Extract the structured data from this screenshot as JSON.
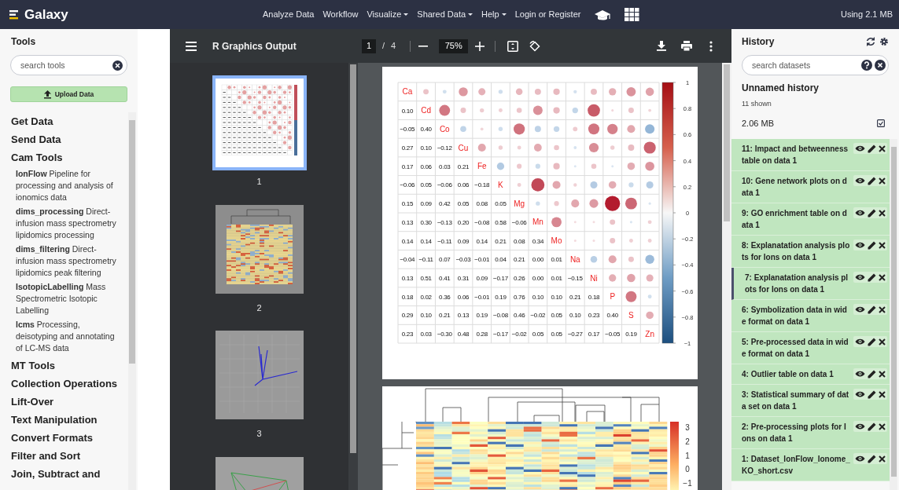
{
  "header": {
    "brand": "Galaxy",
    "nav": [
      {
        "label": "Analyze Data",
        "dropdown": false
      },
      {
        "label": "Workflow",
        "dropdown": false
      },
      {
        "label": "Visualize",
        "dropdown": true
      },
      {
        "label": "Shared Data",
        "dropdown": true
      },
      {
        "label": "Help",
        "dropdown": true
      },
      {
        "label": "Login or Register",
        "dropdown": false
      }
    ],
    "usage": "Using 2.1 MB"
  },
  "tools_panel": {
    "title": "Tools",
    "search": {
      "placeholder": "search tools"
    },
    "upload_button": "Upload Data",
    "sections": [
      {
        "label": "Get Data"
      },
      {
        "label": "Send Data"
      },
      {
        "label": "Cam Tools",
        "children": [
          {
            "text": "**IonFlow** Pipeline for processing and analysis of ionomics data"
          },
          {
            "text": "**dims_processing** Direct-infusion mass spectrometry lipidomics processing"
          },
          {
            "text": "**dims_filtering** Direct-infusion mass spectrometry lipidomics peak filtering"
          },
          {
            "text": "**IsotopicLabelling** Mass Spectrometric Isotopic Labelling"
          },
          {
            "text": "**lcms** Processing, deisotyping and annotating of LC-MS data"
          }
        ]
      },
      {
        "label": "MT Tools"
      },
      {
        "label": "Collection Operations"
      },
      {
        "label": "Lift-Over"
      },
      {
        "label": "Text Manipulation"
      },
      {
        "label": "Convert Formats"
      },
      {
        "label": "Filter and Sort"
      },
      {
        "label": "Join, Subtract and"
      }
    ]
  },
  "viewer": {
    "title": "R Graphics Output",
    "page": "1",
    "separator": "/",
    "total_pages": "4",
    "zoom": "75%",
    "thumbnails": [
      {
        "kind": "corrplot",
        "label": "1",
        "selected": true
      },
      {
        "kind": "heatmap",
        "label": "2",
        "selected": false
      },
      {
        "kind": "scatter",
        "label": "3",
        "selected": false
      },
      {
        "kind": "network",
        "selected": false
      }
    ],
    "correlation_plot": {
      "labels": [
        "Ca",
        "Cd",
        "Co",
        "Cu",
        "Fe",
        "K",
        "Mg",
        "Mn",
        "Mo",
        "Na",
        "Ni",
        "P",
        "S",
        "Zn"
      ],
      "lower": [
        [
          "0.10"
        ],
        [
          "−0.05",
          "0.40"
        ],
        [
          "0.27",
          "0.10",
          "−0.12"
        ],
        [
          "0.17",
          "0.06",
          "0.03",
          "0.21"
        ],
        [
          "−0.06",
          "0.05",
          "−0.06",
          "0.06",
          "−0.18"
        ],
        [
          "0.15",
          "0.09",
          "0.42",
          "0.05",
          "0.08",
          "0.05"
        ],
        [
          "0.13",
          "0.30",
          "−0.13",
          "0.20",
          "−0.08",
          "0.58",
          "−0.06"
        ],
        [
          "0.14",
          "0.14",
          "−0.11",
          "0.09",
          "0.14",
          "0.21",
          "0.08",
          "0.34"
        ],
        [
          "−0.04",
          "−0.11",
          "0.07",
          "−0.03",
          "−0.01",
          "0.04",
          "0.21",
          "0.00",
          "0.01"
        ],
        [
          "0.13",
          "0.51",
          "0.41",
          "0.31",
          "0.09",
          "−0.17",
          "0.26",
          "0.00",
          "0.01",
          "−0.15"
        ],
        [
          "0.18",
          "0.02",
          "0.36",
          "0.06",
          "−0.01",
          "0.19",
          "0.76",
          "0.10",
          "0.10",
          "0.21",
          "0.18"
        ],
        [
          "0.29",
          "0.10",
          "0.21",
          "0.13",
          "0.19",
          "−0.08",
          "0.46",
          "−0.02",
          "0.05",
          "0.10",
          "0.23",
          "0.40"
        ],
        [
          "0.23",
          "0.03",
          "−0.30",
          "0.48",
          "0.28",
          "−0.17",
          "−0.02",
          "0.05",
          "0.05",
          "−0.27",
          "0.17",
          "−0.05",
          "0.19"
        ]
      ],
      "scale_ticks": [
        "1",
        "0.8",
        "0.6",
        "0.4",
        "0.2",
        "0",
        "−0.2",
        "−0.4",
        "−0.6",
        "−0.8",
        "−1"
      ]
    },
    "heatmap": {
      "scale_ticks": [
        "3",
        "2",
        "1",
        "0",
        "−1"
      ]
    }
  },
  "history": {
    "title": "History",
    "search": {
      "placeholder": "search datasets"
    },
    "name": "Unnamed history",
    "shown": "11 shown",
    "size": "2.06 MB",
    "items": [
      {
        "text": "11: Impact and betweenness table on data 1",
        "selected": false
      },
      {
        "text": "10: Gene network plots on data 1",
        "selected": false
      },
      {
        "text": "9: GO enrichment table on data 1",
        "selected": false
      },
      {
        "text": "8: Explanatation analysis plots for Ions on data 1",
        "selected": false
      },
      {
        "text": "7: Explanatation analysis plots for Ions on data 1",
        "selected": true
      },
      {
        "text": "6: Symbolization data in wide format on data 1",
        "selected": false
      },
      {
        "text": "5: Pre-processed data in wide format on data 1",
        "selected": false
      },
      {
        "text": "4: Outlier table on data 1",
        "selected": false
      },
      {
        "text": "3: Statistical summary of data set on data 1",
        "selected": false
      },
      {
        "text": "2: Pre-processing plots for Ions on data 1",
        "selected": false
      },
      {
        "text": "1: Dataset_IonFlow_Ionome_KO_short.csv",
        "selected": false
      }
    ]
  }
}
